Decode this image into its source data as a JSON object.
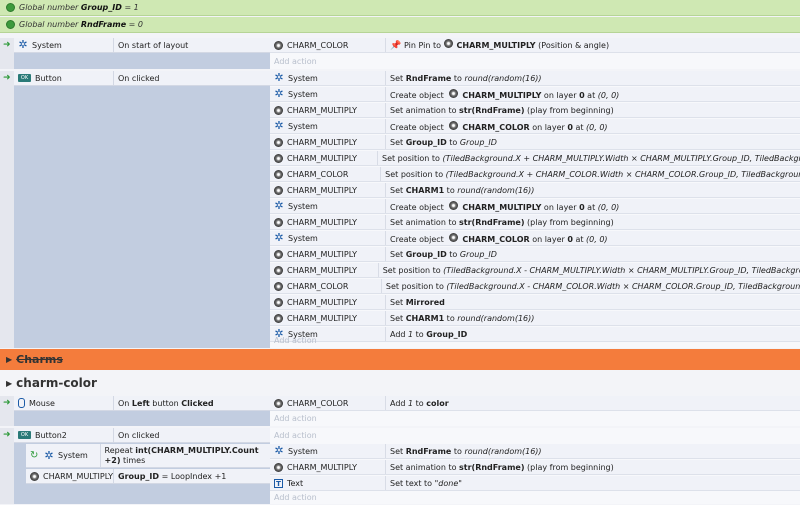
{
  "globals": [
    {
      "prefix": "Global number",
      "name": "Group_ID",
      "rest": "= 1"
    },
    {
      "prefix": "Global number",
      "name": "RndFrame",
      "rest": "= 0"
    }
  ],
  "events": [
    {
      "cond_object": "System",
      "cond_text": "On start of layout",
      "actions": [
        {
          "object": "CHARM_COLOR",
          "text": "Pin Pin to  CHARM_MULTIPLY (Position & angle)"
        }
      ]
    },
    {
      "cond_object": "Button",
      "cond_text": "On clicked",
      "actions": [
        {
          "object": "System",
          "text": "Set RndFrame to round(random(16))"
        },
        {
          "object": "System",
          "text": "Create object  CHARM_MULTIPLY on layer 0 at (0, 0)"
        },
        {
          "object": "CHARM_MULTIPLY",
          "text": "Set animation to str(RndFrame) (play from beginning)"
        },
        {
          "object": "System",
          "text": "Create object  CHARM_COLOR on layer 0 at (0, 0)"
        },
        {
          "object": "CHARM_MULTIPLY",
          "text": "Set Group_ID to Group_ID"
        },
        {
          "object": "CHARM_MULTIPLY",
          "text": "Set position to (TiledBackground.X + CHARM_MULTIPLY.Width × CHARM_MULTIPLY.Group_ID, TiledBackground.Y)"
        },
        {
          "object": "CHARM_COLOR",
          "text": "Set position to (TiledBackground.X + CHARM_COLOR.Width × CHARM_COLOR.Group_ID, TiledBackground.Y)"
        },
        {
          "object": "CHARM_MULTIPLY",
          "text": "Set CHARM1 to round(random(16))"
        },
        {
          "object": "System",
          "text": "Create object  CHARM_MULTIPLY on layer 0 at (0, 0)"
        },
        {
          "object": "CHARM_MULTIPLY",
          "text": "Set animation to str(RndFrame) (play from beginning)"
        },
        {
          "object": "System",
          "text": "Create object  CHARM_COLOR on layer 0 at (0, 0)"
        },
        {
          "object": "CHARM_MULTIPLY",
          "text": "Set Group_ID to Group_ID"
        },
        {
          "object": "CHARM_MULTIPLY",
          "text": "Set position to (TiledBackground.X - CHARM_MULTIPLY.Width × CHARM_MULTIPLY.Group_ID, TiledBackground.Y)"
        },
        {
          "object": "CHARM_COLOR",
          "text": "Set position to (TiledBackground.X - CHARM_COLOR.Width × CHARM_COLOR.Group_ID, TiledBackground.Y)"
        },
        {
          "object": "CHARM_MULTIPLY",
          "text": "Set Mirrored"
        },
        {
          "object": "CHARM_MULTIPLY",
          "text": "Set CHARM1 to round(random(16))"
        },
        {
          "object": "System",
          "text": "Add 1 to Group_ID"
        }
      ]
    },
    {
      "cond_object": "Mouse",
      "cond_text": "On Left button Clicked",
      "actions": [
        {
          "object": "CHARM_COLOR",
          "text": "Add 1 to color"
        }
      ]
    },
    {
      "cond_object": "Button2",
      "cond_text": "On clicked",
      "actions": []
    },
    {
      "cond_object": "System",
      "cond_text": "Repeat int(CHARM_MULTIPLY.Count +2) times",
      "cond2_object": "CHARM_MULTIPLY",
      "cond2_text": "Group_ID = LoopIndex +1",
      "actions": [
        {
          "object": "System",
          "text": "Set RndFrame to round(random(16))"
        },
        {
          "object": "CHARM_MULTIPLY",
          "text": "Set animation to str(RndFrame) (play from beginning)"
        },
        {
          "object": "Text",
          "text": "Set text to \"done\""
        }
      ]
    }
  ],
  "add_action_label": "Add action",
  "groups": [
    {
      "name": "Charms"
    },
    {
      "name": "charm-color"
    }
  ]
}
